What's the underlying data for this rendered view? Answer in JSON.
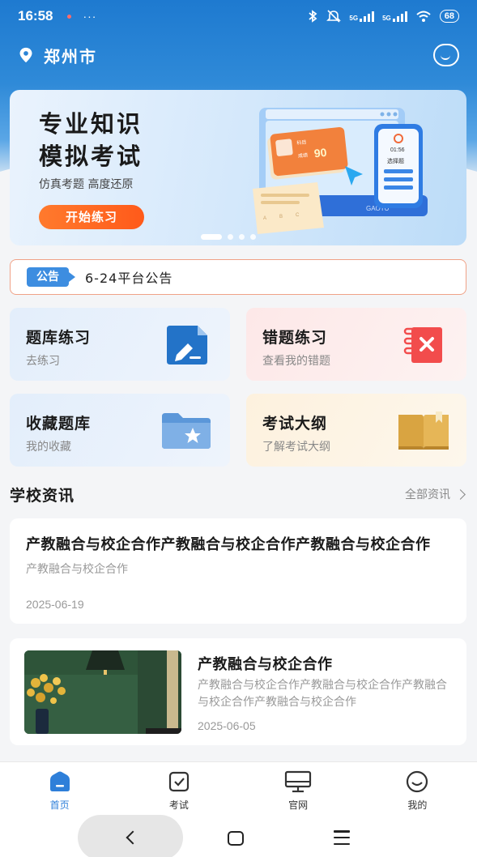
{
  "status_bar": {
    "time": "16:58",
    "more": "···",
    "network_1": "5G",
    "network_2": "5G",
    "battery": "68"
  },
  "header": {
    "city": "郑州市",
    "location_icon": "map-pin-icon",
    "message_icon": "chat-bubble-icon"
  },
  "banner": {
    "title_line1": "专业知识",
    "title_line2": "模拟考试",
    "subtitle": "仿真考题 高度还原",
    "button_label": "开始练习",
    "art_score": "90",
    "art_time": "01:56",
    "art_tab": "选择题",
    "art_brand": "GAOTU",
    "art_field_1": "科目",
    "art_field_2": "成绩",
    "art_field_3": "成绩",
    "art_option_a": "A",
    "art_option_b": "B",
    "art_option_c": "C",
    "page_count": 4,
    "active_page": 1
  },
  "notice": {
    "tag": "公告",
    "text": "6-24平台公告"
  },
  "cards": [
    {
      "title": "题库练习",
      "sub": "去练习",
      "icon": "edit-document-icon"
    },
    {
      "title": "错题练习",
      "sub": "查看我的错题",
      "icon": "wrong-notebook-icon"
    },
    {
      "title": "收藏题库",
      "sub": "我的收藏",
      "icon": "star-folder-icon"
    },
    {
      "title": "考试大纲",
      "sub": "了解考试大纲",
      "icon": "open-book-icon"
    }
  ],
  "school_news": {
    "title": "学校资讯",
    "more_label": "全部资讯",
    "items": [
      {
        "title": "产教融合与校企合作产教融合与校企合作产教融合与校企合作",
        "summary": "产教融合与校企合作",
        "date": "2025-06-19"
      },
      {
        "title": "产教融合与校企合作",
        "summary": "产教融合与校企合作产教融合与校企合作产教融合与校企合作产教融合与校企合作",
        "date": "2025-06-05"
      }
    ]
  },
  "tabbar": {
    "items": [
      {
        "label": "首页",
        "icon": "home-icon",
        "active": true
      },
      {
        "label": "考试",
        "icon": "exam-check-icon",
        "active": false
      },
      {
        "label": "官网",
        "icon": "monitor-icon",
        "active": false
      },
      {
        "label": "我的",
        "icon": "smile-user-icon",
        "active": false
      }
    ]
  },
  "colors": {
    "primary": "#2e7fd9",
    "accent_orange": "#ff6a22",
    "notice_border": "#f0a287"
  }
}
